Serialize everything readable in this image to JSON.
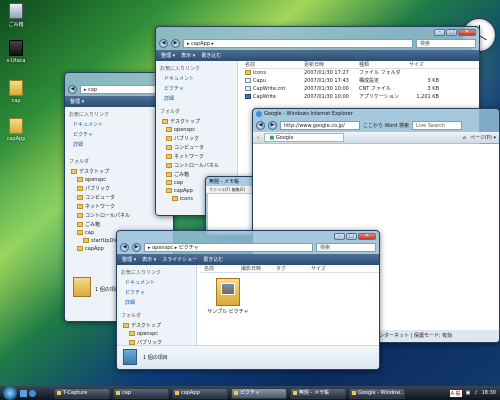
{
  "desktop": {
    "icons": [
      {
        "label": "ごみ箱"
      },
      {
        "label": "s-Utaca"
      },
      {
        "label": "cap"
      },
      {
        "label": "capApp"
      }
    ]
  },
  "win_cap": {
    "title": "cap",
    "address": "cap",
    "left": {
      "header": "お気に入りリンク",
      "links": [
        "ドキュメント",
        "ピクチャ",
        "詳細"
      ],
      "folders_header": "フォルダ",
      "tree": [
        "デスクトップ",
        "openspc",
        "パブリック",
        "コンピュータ",
        "ネットワーク",
        "コントロールパネル",
        "ごみ箱",
        "cap",
        "startUpDir",
        "capApp"
      ]
    },
    "status": "1 個の項目"
  },
  "win_capapp": {
    "address": "capApp",
    "search_placeholder": "検索",
    "toolbar": [
      "整理",
      "表示",
      "書き込む"
    ],
    "left": {
      "header": "お気に入りリンク",
      "links": [
        "ドキュメント",
        "ピクチャ",
        "詳細"
      ],
      "folders_header": "フォルダ",
      "tree": [
        "デスクトップ",
        "openspc",
        "パブリック",
        "コンピュータ",
        "ネットワーク",
        "コントロールパネル",
        "ごみ箱",
        "cap",
        "capApp",
        "icons"
      ]
    },
    "columns": [
      "名前",
      "更新日時",
      "種類",
      "サイズ"
    ],
    "rows": [
      {
        "name": "icons",
        "date": "2007/01/30 17:27",
        "type": "ファイル フォルダ",
        "size": ""
      },
      {
        "name": "Capu",
        "date": "2007/01/30 17:43",
        "type": "構成設定",
        "size": "3 KB"
      },
      {
        "name": "CapWrite.cnt",
        "date": "2007/01/30 10:00",
        "type": "CNT ファイル",
        "size": "3 KB"
      },
      {
        "name": "CapWrite",
        "date": "2007/01/30 10:00",
        "type": "アプリケーション",
        "size": "1,201 KB"
      }
    ]
  },
  "win_notepad": {
    "title": "無題 - メモ帳",
    "menu": "ファイル(F)  編集(E)"
  },
  "win_ie": {
    "title": "Google - Windows Internet Explorer",
    "url": "http://www.google.co.jp/",
    "search_label": "Live Search",
    "tab": "Google",
    "status_zone": "インターネット | 保護モード: 有効",
    "inline_text": "ここから Word 検索",
    "page_label": "ページ(P)"
  },
  "win_pictures": {
    "address": "openspc ▸ ピクチャ",
    "search_placeholder": "検索",
    "toolbar": [
      "整理",
      "表示",
      "スライドショー",
      "書き込む"
    ],
    "left": {
      "header": "お気に入りリンク",
      "links": [
        "ドキュメント",
        "ピクチャ",
        "詳細"
      ],
      "folders_header": "フォルダ",
      "tree": [
        "デスクトップ",
        "openspc",
        "パブリック"
      ]
    },
    "columns": [
      "名前",
      "撮影日時",
      "タグ",
      "サイズ"
    ],
    "item": "サンプル ピクチャ",
    "status": "1 個の項目"
  },
  "taskbar": {
    "buttons": [
      "T-Capture",
      "cap",
      "capApp",
      "ピクチャ",
      "無題 - メモ帳",
      "Google - Window..."
    ],
    "lang": "A 般",
    "time": "18:30"
  }
}
